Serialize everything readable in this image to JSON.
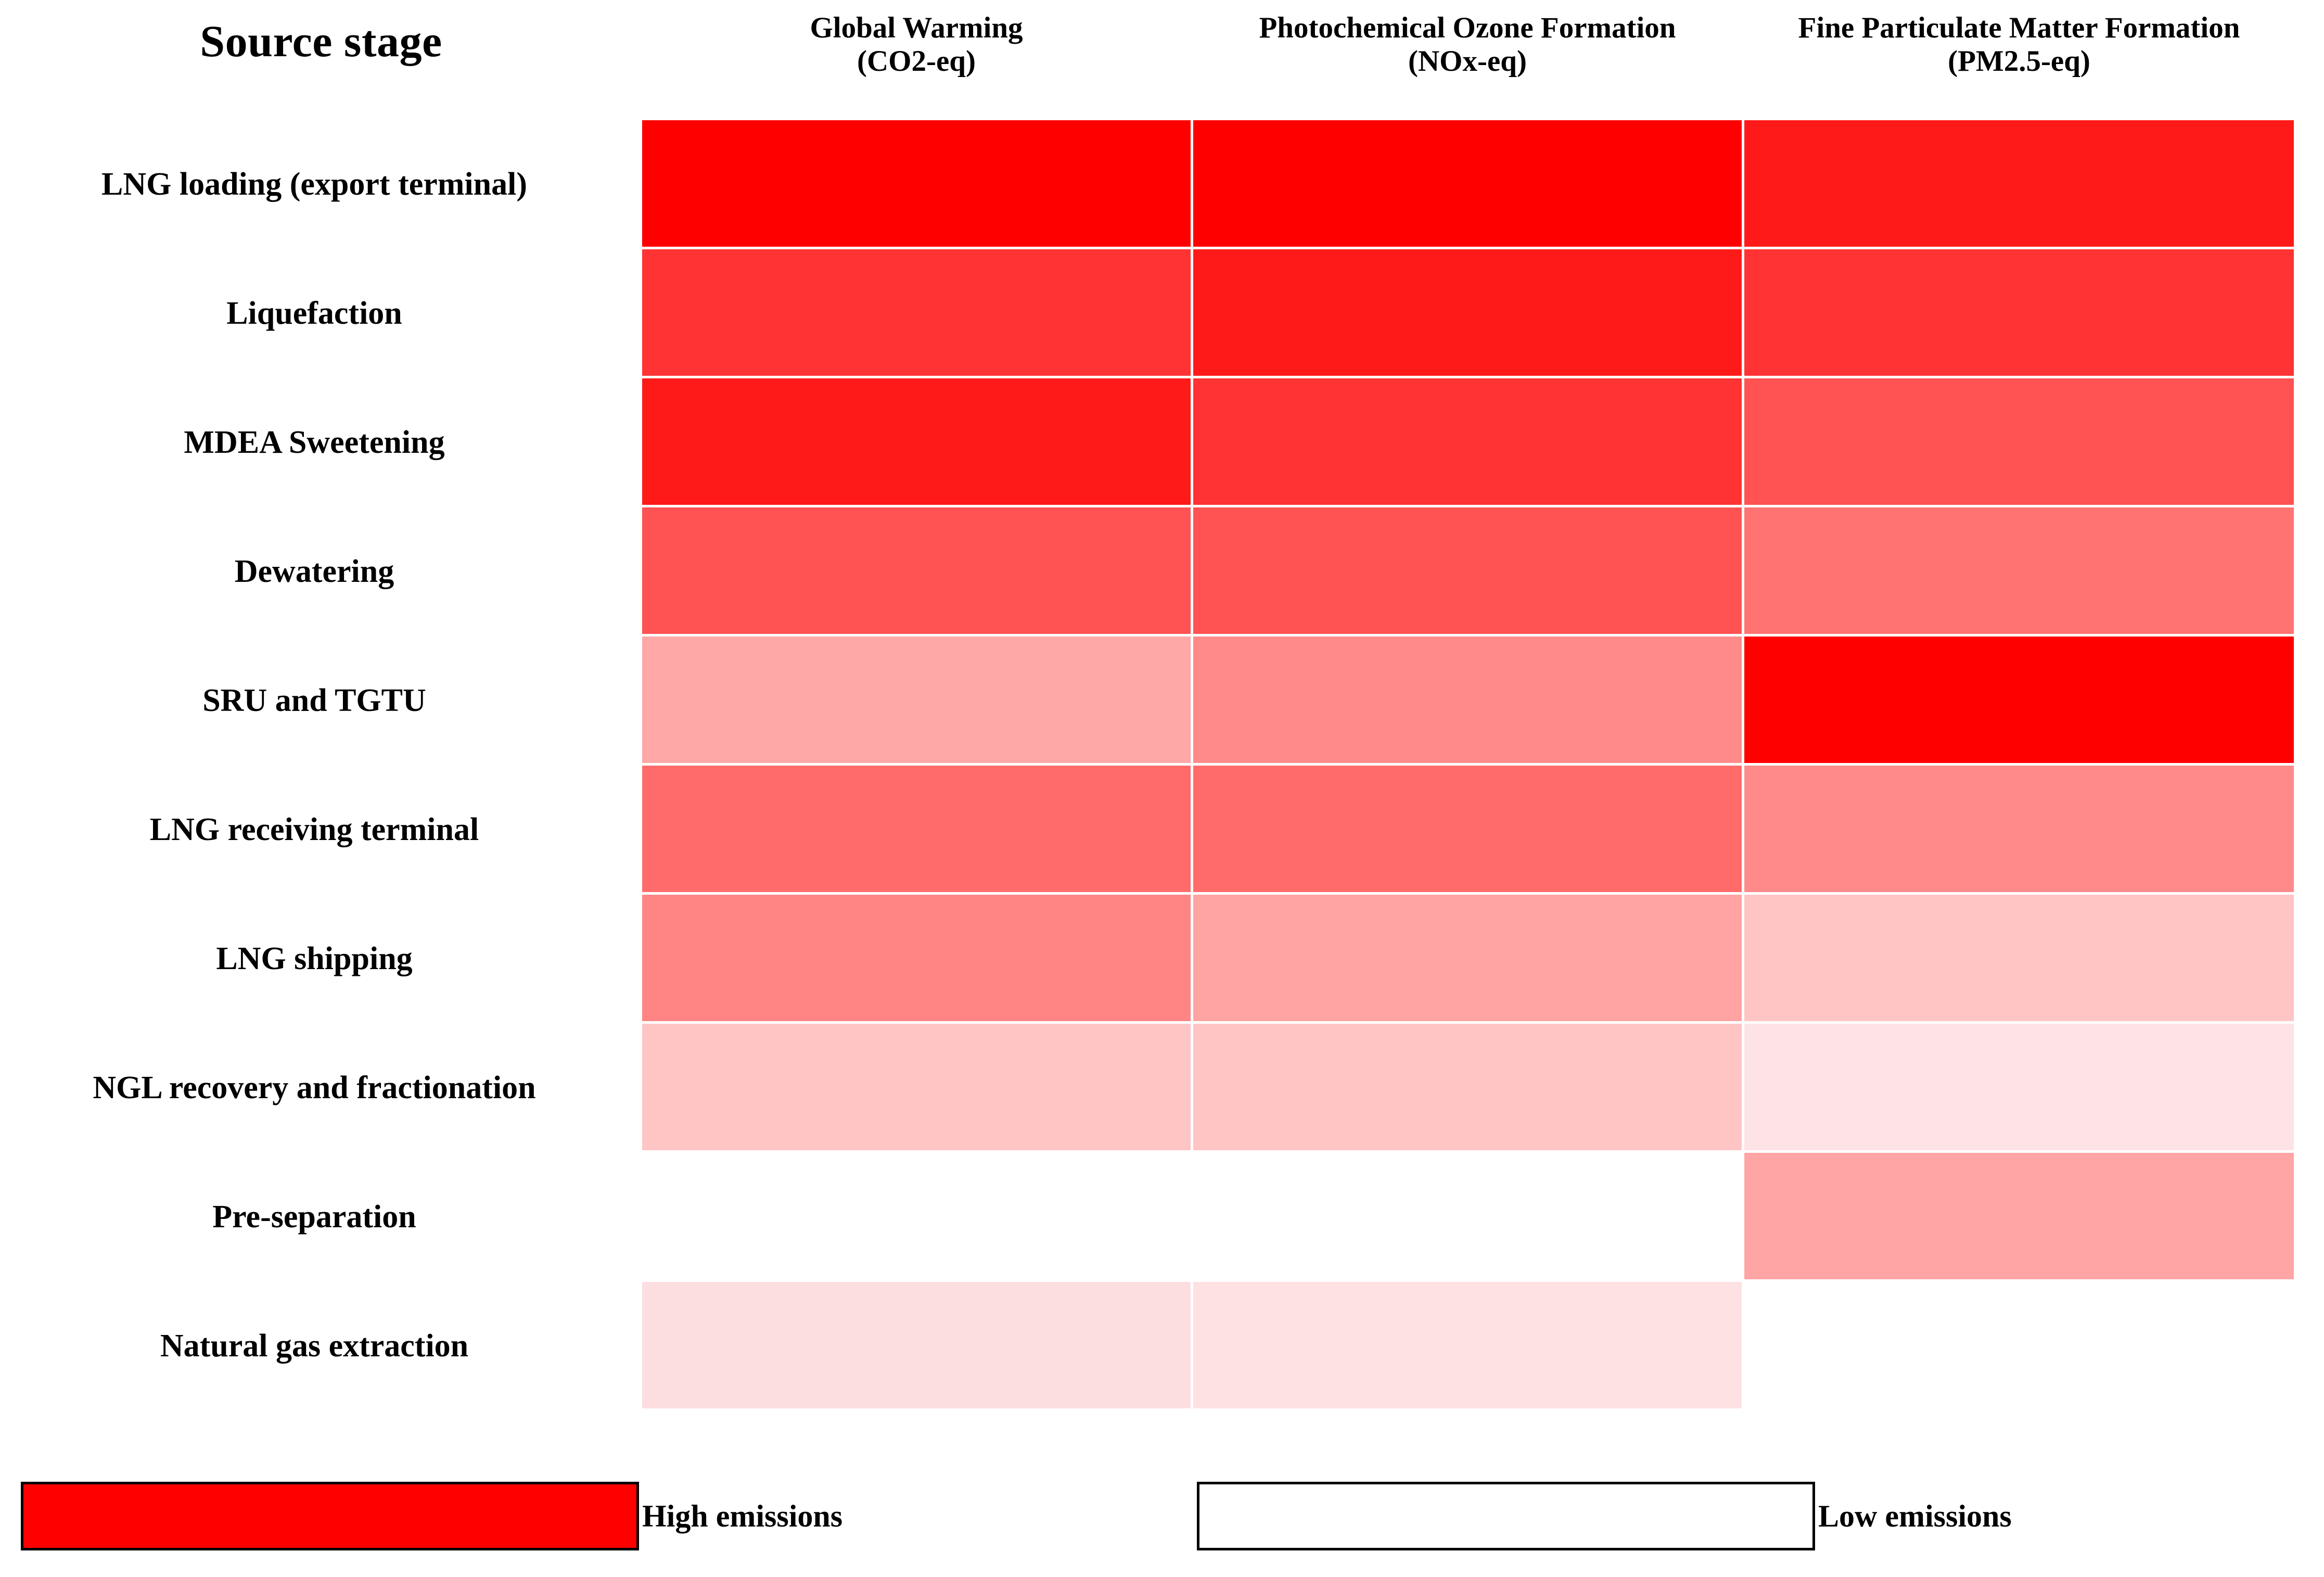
{
  "header": {
    "row_axis_title": "Source stage",
    "columns": [
      {
        "name": "Global Warming",
        "unit": "(CO2-eq)"
      },
      {
        "name": "Photochemical Ozone Formation",
        "unit": "(NOx-eq)"
      },
      {
        "name": "Fine Particulate Matter Formation",
        "unit": "(PM2.5-eq)"
      }
    ]
  },
  "legend": {
    "high": {
      "label": "High emissions",
      "color": "#FF0000"
    },
    "low": {
      "label": "Low emissions",
      "color": "#FFFFFF"
    },
    "border_color": "#000000"
  },
  "chart_data": {
    "type": "heatmap",
    "title": "",
    "xlabel": "",
    "ylabel": "Source stage",
    "grid": false,
    "legend_position": "bottom",
    "colorscale": {
      "low_color": "#FFFFFF",
      "high_color": "#FF0000",
      "low_label": "Low emissions",
      "high_label": "High emissions"
    },
    "columns": [
      "Global Warming (CO2-eq)",
      "Photochemical Ozone Formation (NOx-eq)",
      "Fine Particulate Matter Formation (PM2.5-eq)"
    ],
    "rows": [
      "LNG loading (export terminal)",
      "Liquefaction",
      "MDEA Sweetening",
      "Dewatering",
      "SRU and TGTU",
      "LNG receiving terminal",
      "LNG shipping",
      "NGL recovery and fractionation",
      "Pre-separation",
      "Natural gas extraction"
    ],
    "cells": [
      {
        "row": "LNG loading (export terminal)",
        "values": [
          {
            "column": "Global Warming (CO2-eq)",
            "color": "#FF0000",
            "intensity": 1.0
          },
          {
            "column": "Photochemical Ozone Formation (NOx-eq)",
            "color": "#FF0000",
            "intensity": 1.0
          },
          {
            "column": "Fine Particulate Matter Formation (PM2.5-eq)",
            "color": "#FF1A1A",
            "intensity": 0.9
          }
        ]
      },
      {
        "row": "Liquefaction",
        "values": [
          {
            "column": "Global Warming (CO2-eq)",
            "color": "#FF3333",
            "intensity": 0.8
          },
          {
            "column": "Photochemical Ozone Formation (NOx-eq)",
            "color": "#FF1A1A",
            "intensity": 0.9
          },
          {
            "column": "Fine Particulate Matter Formation (PM2.5-eq)",
            "color": "#FF3333",
            "intensity": 0.8
          }
        ]
      },
      {
        "row": "MDEA Sweetening",
        "values": [
          {
            "column": "Global Warming (CO2-eq)",
            "color": "#FF1A1A",
            "intensity": 0.9
          },
          {
            "column": "Photochemical Ozone Formation (NOx-eq)",
            "color": "#FF3333",
            "intensity": 0.8
          },
          {
            "column": "Fine Particulate Matter Formation (PM2.5-eq)",
            "color": "#FF5252",
            "intensity": 0.68
          }
        ]
      },
      {
        "row": "Dewatering",
        "values": [
          {
            "column": "Global Warming (CO2-eq)",
            "color": "#FF5252",
            "intensity": 0.68
          },
          {
            "column": "Photochemical Ozone Formation (NOx-eq)",
            "color": "#FF5252",
            "intensity": 0.68
          },
          {
            "column": "Fine Particulate Matter Formation (PM2.5-eq)",
            "color": "#FF7373",
            "intensity": 0.55
          }
        ]
      },
      {
        "row": "SRU and TGTU",
        "values": [
          {
            "column": "Global Warming (CO2-eq)",
            "color": "#FFA8A8",
            "intensity": 0.34
          },
          {
            "column": "Photochemical Ozone Formation (NOx-eq)",
            "color": "#FF8A8A",
            "intensity": 0.46
          },
          {
            "column": "Fine Particulate Matter Formation (PM2.5-eq)",
            "color": "#FF0000",
            "intensity": 1.0
          }
        ]
      },
      {
        "row": "LNG receiving terminal",
        "values": [
          {
            "column": "Global Warming (CO2-eq)",
            "color": "#FF6B6B",
            "intensity": 0.58
          },
          {
            "column": "Photochemical Ozone Formation (NOx-eq)",
            "color": "#FF6B6B",
            "intensity": 0.58
          },
          {
            "column": "Fine Particulate Matter Formation (PM2.5-eq)",
            "color": "#FF8A8A",
            "intensity": 0.46
          }
        ]
      },
      {
        "row": "LNG shipping",
        "values": [
          {
            "column": "Global Warming (CO2-eq)",
            "color": "#FF8585",
            "intensity": 0.48
          },
          {
            "column": "Photochemical Ozone Formation (NOx-eq)",
            "color": "#FFA3A3",
            "intensity": 0.36
          },
          {
            "column": "Fine Particulate Matter Formation (PM2.5-eq)",
            "color": "#FFC4C4",
            "intensity": 0.23
          }
        ]
      },
      {
        "row": "NGL recovery and fractionation",
        "values": [
          {
            "column": "Global Warming (CO2-eq)",
            "color": "#FFC4C4",
            "intensity": 0.23
          },
          {
            "column": "Photochemical Ozone Formation (NOx-eq)",
            "color": "#FFC4C4",
            "intensity": 0.23
          },
          {
            "column": "Fine Particulate Matter Formation (PM2.5-eq)",
            "color": "#FDE3E5",
            "intensity": 0.11
          }
        ]
      },
      {
        "row": "Pre-separation",
        "values": [
          {
            "column": "Global Warming (CO2-eq)",
            "color": "#FFFFFF",
            "intensity": null
          },
          {
            "column": "Photochemical Ozone Formation (NOx-eq)",
            "color": "#FFFFFF",
            "intensity": null
          },
          {
            "column": "Fine Particulate Matter Formation (PM2.5-eq)",
            "color": "#FFA5A5",
            "intensity": 0.35
          }
        ]
      },
      {
        "row": "Natural gas extraction",
        "values": [
          {
            "column": "Global Warming (CO2-eq)",
            "color": "#FDDEE0",
            "intensity": 0.09
          },
          {
            "column": "Photochemical Ozone Formation (NOx-eq)",
            "color": "#FDE1E3",
            "intensity": 0.08
          },
          {
            "column": "Fine Particulate Matter Formation (PM2.5-eq)",
            "color": "#FFFFFF",
            "intensity": null
          }
        ]
      }
    ]
  }
}
